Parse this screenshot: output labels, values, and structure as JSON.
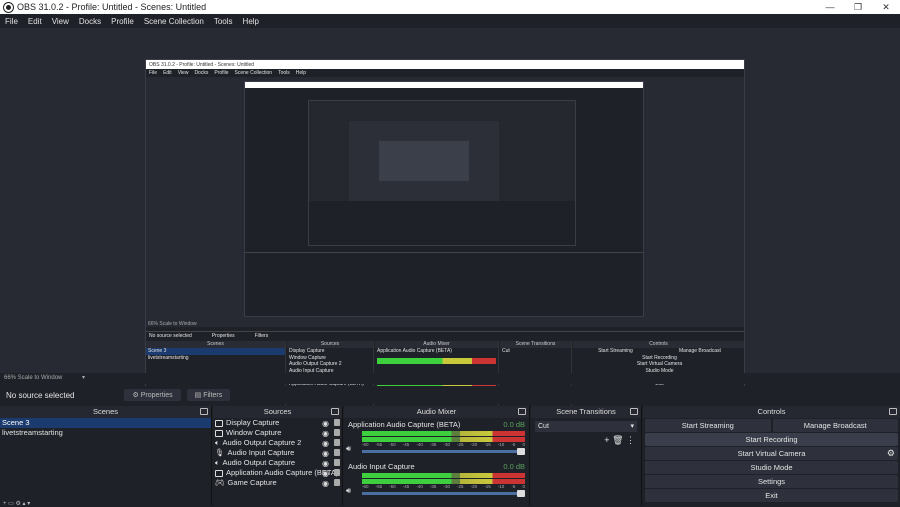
{
  "window": {
    "title": "OBS 31.0.2 - Profile: Untitled - Scenes: Untitled"
  },
  "menu": [
    "File",
    "Edit",
    "View",
    "Docks",
    "Profile",
    "Scene Collection",
    "Tools",
    "Help"
  ],
  "nested": {
    "title": "OBS 31.0.2 - Profile: Untitled - Scenes: Untitled",
    "scale": "66% Scale to Window",
    "no_source": "No source selected",
    "properties": "Properties",
    "filters": "Filters"
  },
  "toolbar": {
    "scale": "66% Scale to Window",
    "no_source": "No source selected",
    "properties": "Properties",
    "filters": "Filters"
  },
  "scenes": {
    "title": "Scenes",
    "items": [
      "Scene 3",
      "livetstreamstarting"
    ],
    "selected": 0
  },
  "sources": {
    "title": "Sources",
    "items": [
      "Display Capture",
      "Window Capture",
      "Audio Output Capture 2",
      "Audio Input Capture",
      "Audio Output Capture",
      "Application Audio Capture (BETA)",
      "Game Capture"
    ]
  },
  "mixer": {
    "title": "Audio Mixer",
    "channels": [
      {
        "name": "Application Audio Capture (BETA)",
        "db": "0.0 dB"
      },
      {
        "name": "Audio Input Capture",
        "db": "0.0 dB"
      }
    ],
    "ticks": [
      "-60",
      "-55",
      "-50",
      "-45",
      "-40",
      "-35",
      "-30",
      "-25",
      "-20",
      "-15",
      "-10",
      "-5",
      "0"
    ]
  },
  "transitions": {
    "title": "Scene Transitions",
    "selected": "Cut"
  },
  "controls": {
    "title": "Controls",
    "start_streaming": "Start Streaming",
    "manage_broadcast": "Manage Broadcast",
    "start_recording": "Start Recording",
    "start_virtual_camera": "Start Virtual Camera",
    "studio_mode": "Studio Mode",
    "settings": "Settings",
    "exit": "Exit"
  }
}
